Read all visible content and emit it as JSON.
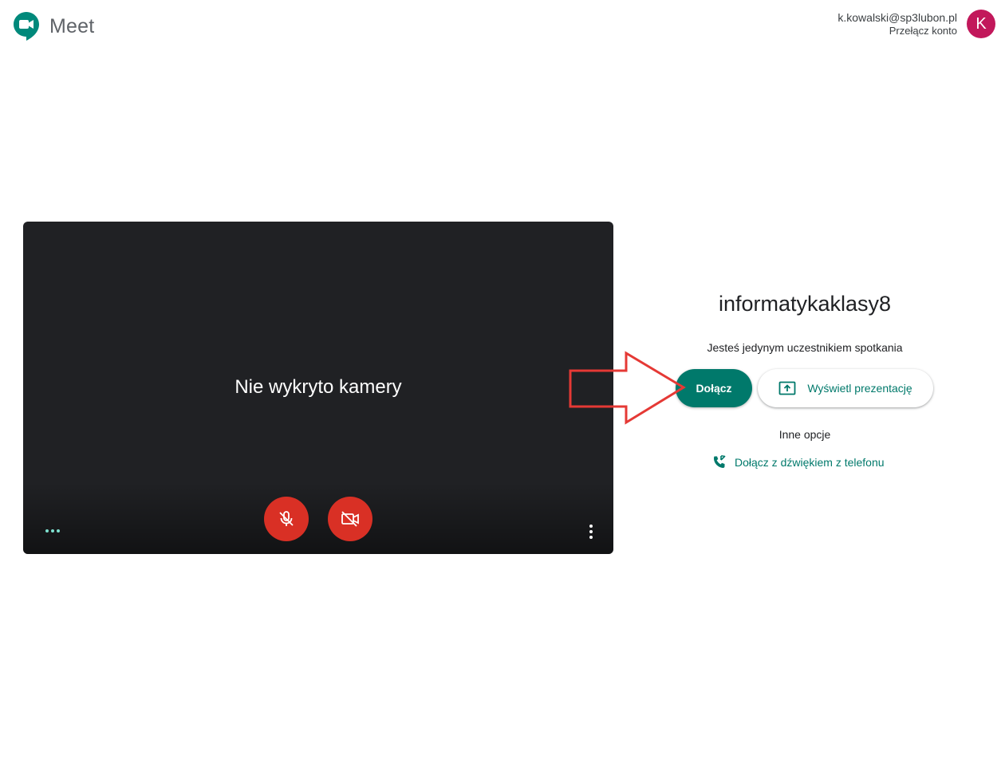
{
  "header": {
    "logo_text": "Meet",
    "account_email": "k.kowalski@sp3lubon.pl",
    "switch_account": "Przełącz konto",
    "avatar_letter": "K",
    "avatar_color": "#c2185b"
  },
  "preview": {
    "status_text": "Nie wykryto kamery",
    "mic_state": "muted",
    "camera_state": "off"
  },
  "meeting": {
    "name": "informatykaklasy8",
    "participants_text": "Jesteś jedynym uczestnikiem spotkania",
    "join_label": "Dołącz",
    "present_label": "Wyświetl prezentację",
    "other_options_label": "Inne opcje",
    "phone_audio_label": "Dołącz z dźwiękiem z telefonu"
  },
  "colors": {
    "accent": "#00796b",
    "danger": "#d93025",
    "preview_bg": "#202124",
    "annotation": "#e53935"
  },
  "icons": [
    "meet-logo-icon",
    "mic-off-icon",
    "camera-off-icon",
    "more-vert-icon",
    "present-screen-icon",
    "phone-forward-icon"
  ]
}
